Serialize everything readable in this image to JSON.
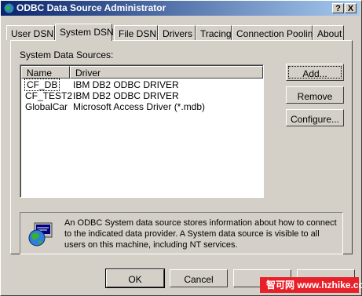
{
  "window": {
    "title": "ODBC Data Source Administrator"
  },
  "title_buttons": {
    "help": "?",
    "close": "X"
  },
  "tabs": [
    {
      "label": "User DSN"
    },
    {
      "label": "System DSN"
    },
    {
      "label": "File DSN"
    },
    {
      "label": "Drivers"
    },
    {
      "label": "Tracing"
    },
    {
      "label": "Connection Pooling"
    },
    {
      "label": "About"
    }
  ],
  "active_tab": "System DSN",
  "system_sources": {
    "label": "System Data Sources:",
    "columns": [
      "Name",
      "Driver"
    ],
    "rows": [
      {
        "name": "CF_DB",
        "driver": "IBM DB2 ODBC DRIVER"
      },
      {
        "name": "CF_TEST2",
        "driver": "IBM DB2 ODBC DRIVER"
      },
      {
        "name": "GlobalCar",
        "driver": "Microsoft Access Driver (*.mdb)"
      }
    ]
  },
  "side_buttons": {
    "add": "Add...",
    "remove": "Remove",
    "configure": "Configure..."
  },
  "info": {
    "text": "An ODBC System data source stores information about how to connect to the indicated data provider.  A System data source is visible to all users on this machine, including NT services."
  },
  "bottom_buttons": {
    "ok": "OK",
    "cancel": "Cancel",
    "apply": "",
    "help": ""
  },
  "watermark": {
    "text": "智可网 www.hzhike.com"
  }
}
